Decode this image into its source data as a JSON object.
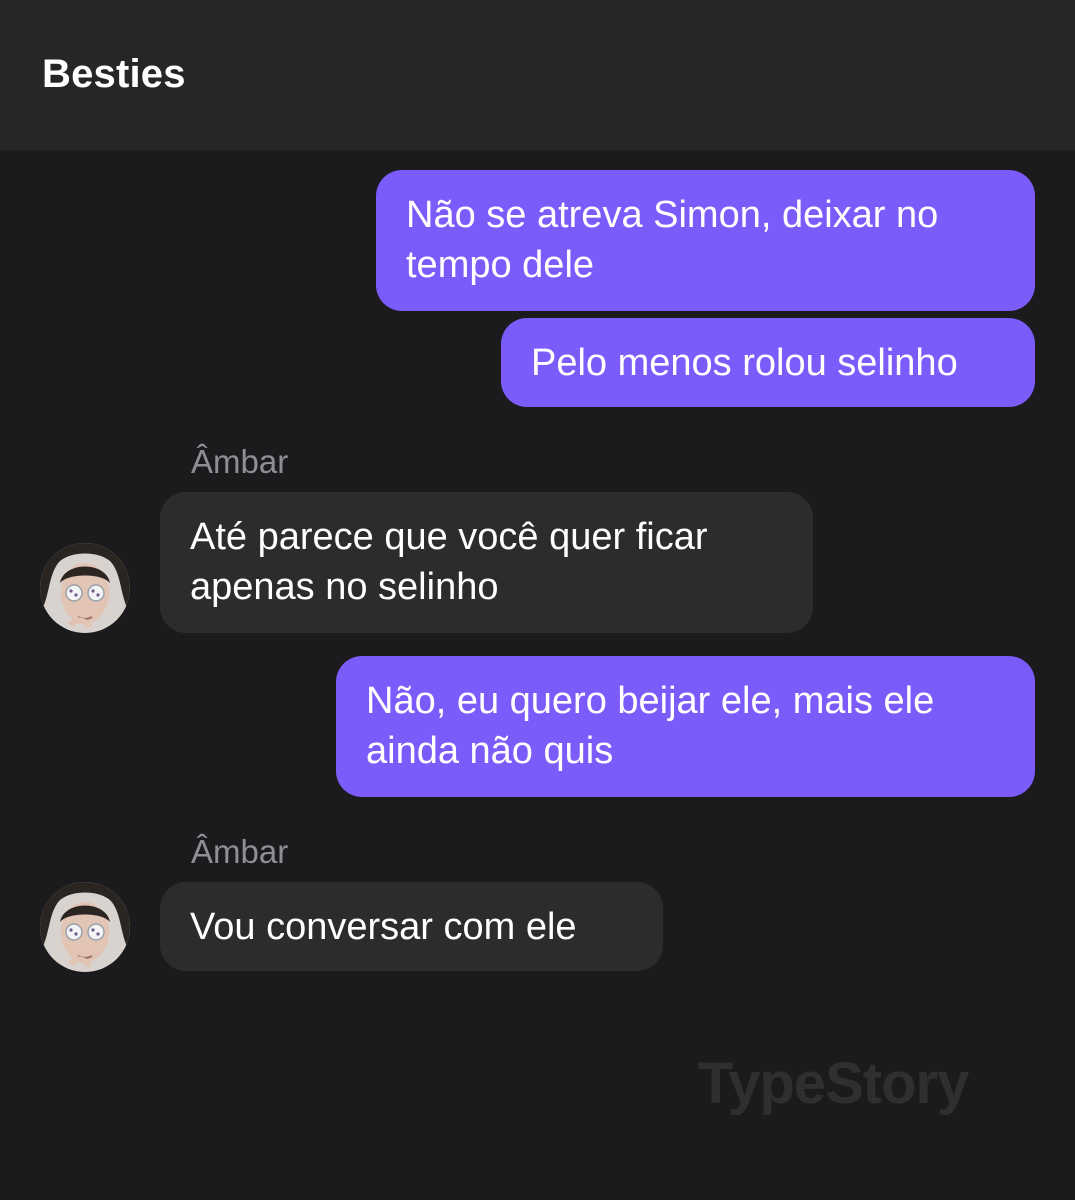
{
  "header": {
    "title": "Besties"
  },
  "messages": [
    {
      "direction": "outgoing",
      "lines": [
        "Não se atreva Simon, deixar no",
        "tempo dele"
      ]
    },
    {
      "direction": "outgoing",
      "lines": [
        "Pelo menos rolou selinho"
      ]
    },
    {
      "direction": "incoming",
      "sender": "Âmbar",
      "lines": [
        "Até parece que você quer ficar",
        "apenas no selinho"
      ],
      "avatar_icon": "contact-photo"
    },
    {
      "direction": "outgoing",
      "lines": [
        "Não, eu quero beijar ele, mais ele",
        "ainda não quis"
      ]
    },
    {
      "direction": "incoming",
      "sender": "Âmbar",
      "lines": [
        "Vou conversar com ele"
      ],
      "avatar_icon": "contact-photo"
    }
  ],
  "watermark": "TypeStory",
  "colors": {
    "outgoing_bubble": "#7b5cfb",
    "incoming_bubble": "#2c2c2e",
    "background": "#1b1b1d",
    "header": "#262628"
  }
}
